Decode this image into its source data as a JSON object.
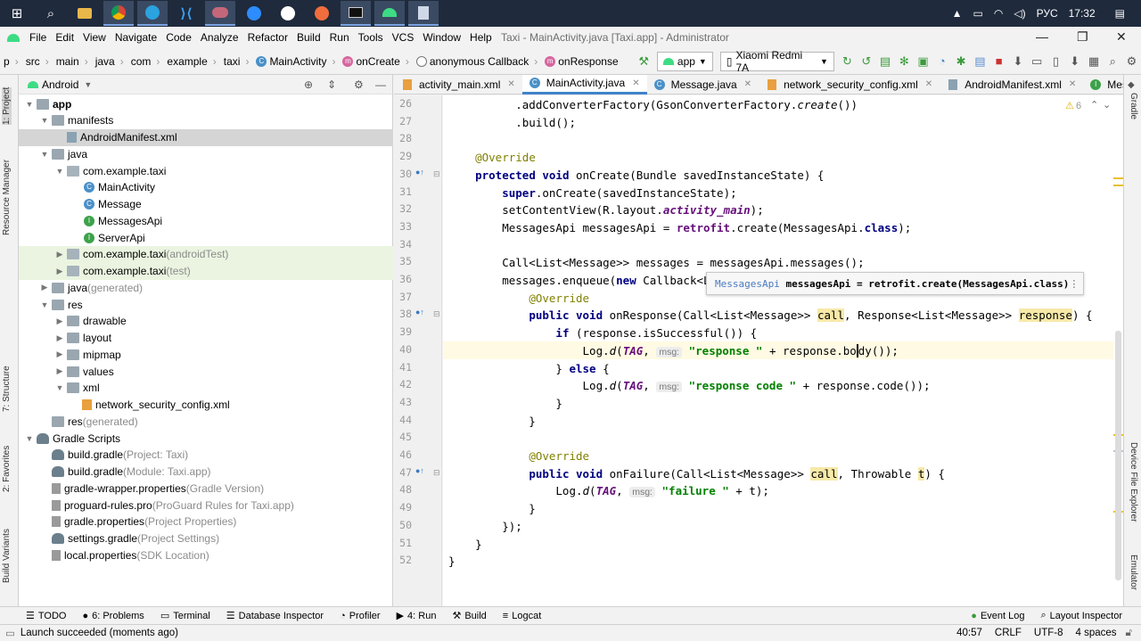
{
  "taskbar": {
    "lang": "РУС",
    "time": "17:32"
  },
  "menu": {
    "items": [
      "File",
      "Edit",
      "View",
      "Navigate",
      "Code",
      "Analyze",
      "Refactor",
      "Build",
      "Run",
      "Tools",
      "VCS",
      "Window",
      "Help"
    ],
    "window_title": "Taxi - MainActivity.java [Taxi.app] - Administrator"
  },
  "nav": {
    "crumbs": [
      "p",
      "src",
      "main",
      "java",
      "com",
      "example",
      "taxi",
      "MainActivity",
      "onCreate",
      "anonymous Callback",
      "onResponse"
    ],
    "run_config": "app",
    "device": "Xiaomi Redmi 7A"
  },
  "left_tabs": [
    "1: Project",
    "Resource Manager",
    "7: Structure",
    "2: Favorites",
    "Build Variants"
  ],
  "right_tabs": [
    "Gradle",
    "Device File Explorer",
    "Emulator"
  ],
  "project": {
    "view": "Android",
    "tree": [
      {
        "label": "app",
        "extra": "",
        "bold": true
      },
      {
        "label": "manifests",
        "extra": ""
      },
      {
        "label": "AndroidManifest.xml",
        "extra": ""
      },
      {
        "label": "java",
        "extra": ""
      },
      {
        "label": "com.example.taxi",
        "extra": ""
      },
      {
        "label": "MainActivity",
        "extra": ""
      },
      {
        "label": "Message",
        "extra": ""
      },
      {
        "label": "MessagesApi",
        "extra": ""
      },
      {
        "label": "ServerApi",
        "extra": ""
      },
      {
        "label": "com.example.taxi",
        "extra": " (androidTest)"
      },
      {
        "label": "com.example.taxi",
        "extra": " (test)"
      },
      {
        "label": "java",
        "extra": " (generated)"
      },
      {
        "label": "res",
        "extra": ""
      },
      {
        "label": "drawable",
        "extra": ""
      },
      {
        "label": "layout",
        "extra": ""
      },
      {
        "label": "mipmap",
        "extra": ""
      },
      {
        "label": "values",
        "extra": ""
      },
      {
        "label": "xml",
        "extra": ""
      },
      {
        "label": "network_security_config.xml",
        "extra": ""
      },
      {
        "label": "res",
        "extra": " (generated)"
      },
      {
        "label": "Gradle Scripts",
        "extra": ""
      },
      {
        "label": "build.gradle",
        "extra": " (Project: Taxi)"
      },
      {
        "label": "build.gradle",
        "extra": " (Module: Taxi.app)"
      },
      {
        "label": "gradle-wrapper.properties",
        "extra": " (Gradle Version)"
      },
      {
        "label": "proguard-rules.pro",
        "extra": " (ProGuard Rules for Taxi.app)"
      },
      {
        "label": "gradle.properties",
        "extra": " (Project Properties)"
      },
      {
        "label": "settings.gradle",
        "extra": " (Project Settings)"
      },
      {
        "label": "local.properties",
        "extra": " (SDK Location)"
      }
    ]
  },
  "tabs": [
    "activity_main.xml",
    "MainActivity.java",
    "Message.java",
    "network_security_config.xml",
    "AndroidManifest.xml",
    "Messages"
  ],
  "editor": {
    "warnings": "6",
    "line_numbers": [
      "26",
      "27",
      "28",
      "29",
      "30",
      "31",
      "32",
      "33",
      "34",
      "35",
      "36",
      "37",
      "38",
      "39",
      "40",
      "41",
      "42",
      "43",
      "44",
      "45",
      "46",
      "47",
      "48",
      "49",
      "50",
      "51",
      "52"
    ],
    "hint_msg": "msg:",
    "tooltip": {
      "type": "MessagesApi",
      "text": "messagesApi = retrofit.create(MessagesApi.class)"
    }
  },
  "bottom_tabs": [
    "TODO",
    "6: Problems",
    "Terminal",
    "Database Inspector",
    "Profiler",
    "4: Run",
    "Build",
    "Logcat",
    "Event Log",
    "Layout Inspector"
  ],
  "status": {
    "message": "Launch succeeded (moments ago)",
    "position": "40:57",
    "line_sep": "CRLF",
    "encoding": "UTF-8",
    "indent": "4 spaces"
  },
  "colors": {
    "accent": "#4083c9",
    "selection": "#d5d5d5",
    "test_bg": "#eaf4e0",
    "current_line": "#fffae3"
  }
}
